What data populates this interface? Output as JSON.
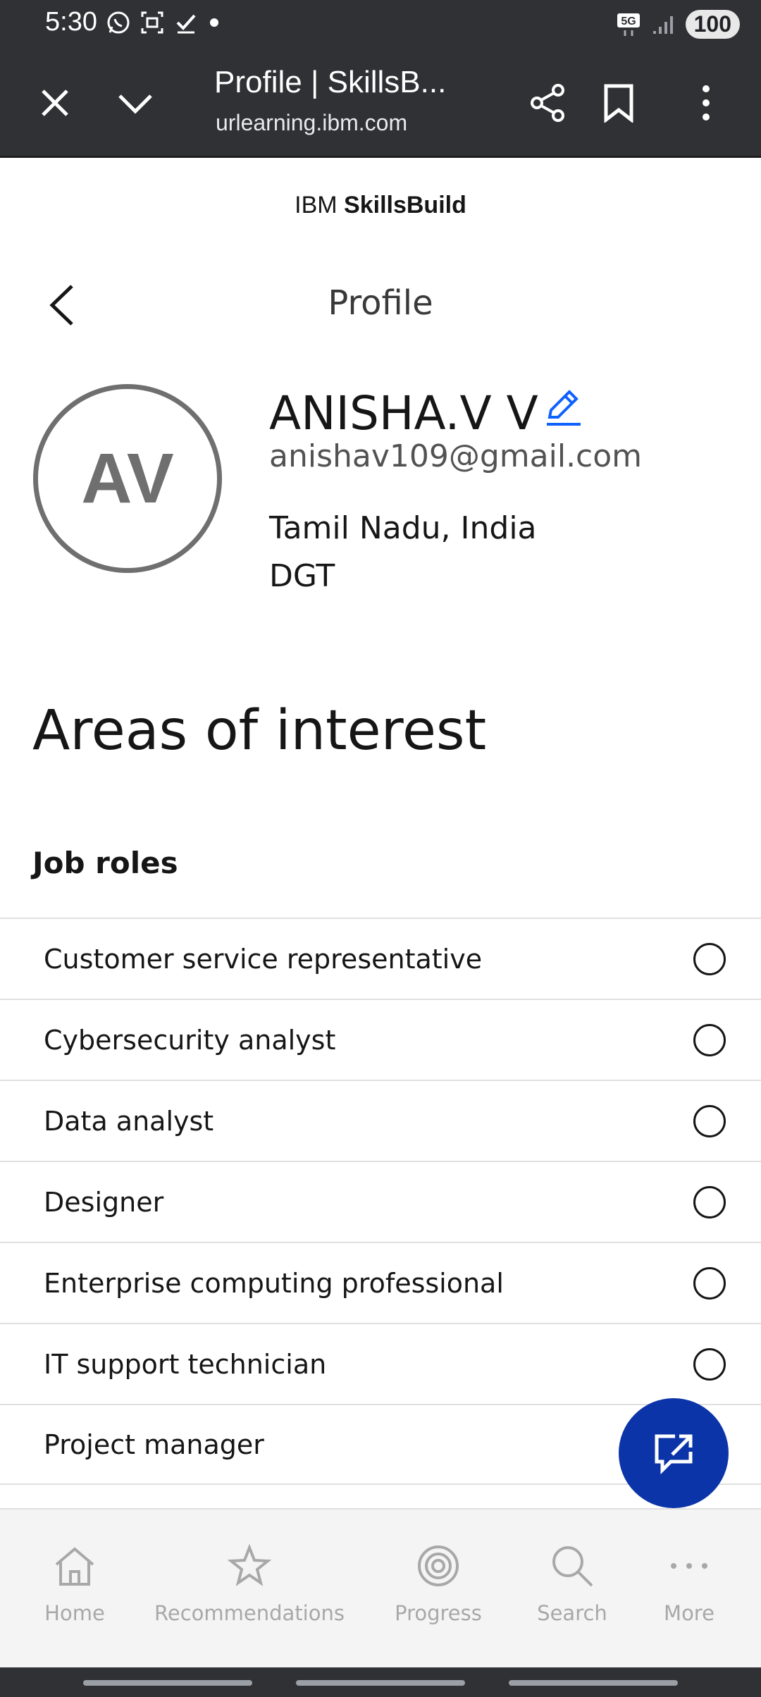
{
  "status_bar": {
    "time": "5:30",
    "network": "5G",
    "battery": "100"
  },
  "tab_bar": {
    "title": "Profile | SkillsB...",
    "url": "urlearning.ibm.com"
  },
  "brand": {
    "prefix": "IBM ",
    "name": "SkillsBuild"
  },
  "header": {
    "title": "Profile"
  },
  "profile": {
    "initials": "AV",
    "name": "ANISHA.V V",
    "email": "anishav109@gmail.com",
    "location": "Tamil Nadu, India",
    "organization": "DGT"
  },
  "interests": {
    "title": "Areas of interest",
    "job_roles_title": "Job roles",
    "job_roles": [
      {
        "label": "Customer service representative",
        "selected": false
      },
      {
        "label": "Cybersecurity analyst",
        "selected": false
      },
      {
        "label": "Data analyst",
        "selected": false
      },
      {
        "label": "Designer",
        "selected": false
      },
      {
        "label": "Enterprise computing professional",
        "selected": false
      },
      {
        "label": "IT support technician",
        "selected": false
      },
      {
        "label": "Project manager",
        "selected": false
      }
    ]
  },
  "bottom_nav": {
    "items": [
      {
        "label": "Home",
        "icon": "home-icon"
      },
      {
        "label": "Recommendations",
        "icon": "star-icon"
      },
      {
        "label": "Progress",
        "icon": "progress-icon"
      },
      {
        "label": "Search",
        "icon": "search-icon"
      },
      {
        "label": "More",
        "icon": "more-icon"
      }
    ]
  },
  "colors": {
    "accent": "#0f62fe",
    "fab": "#0b34a8",
    "chrome_bar": "#303134"
  }
}
